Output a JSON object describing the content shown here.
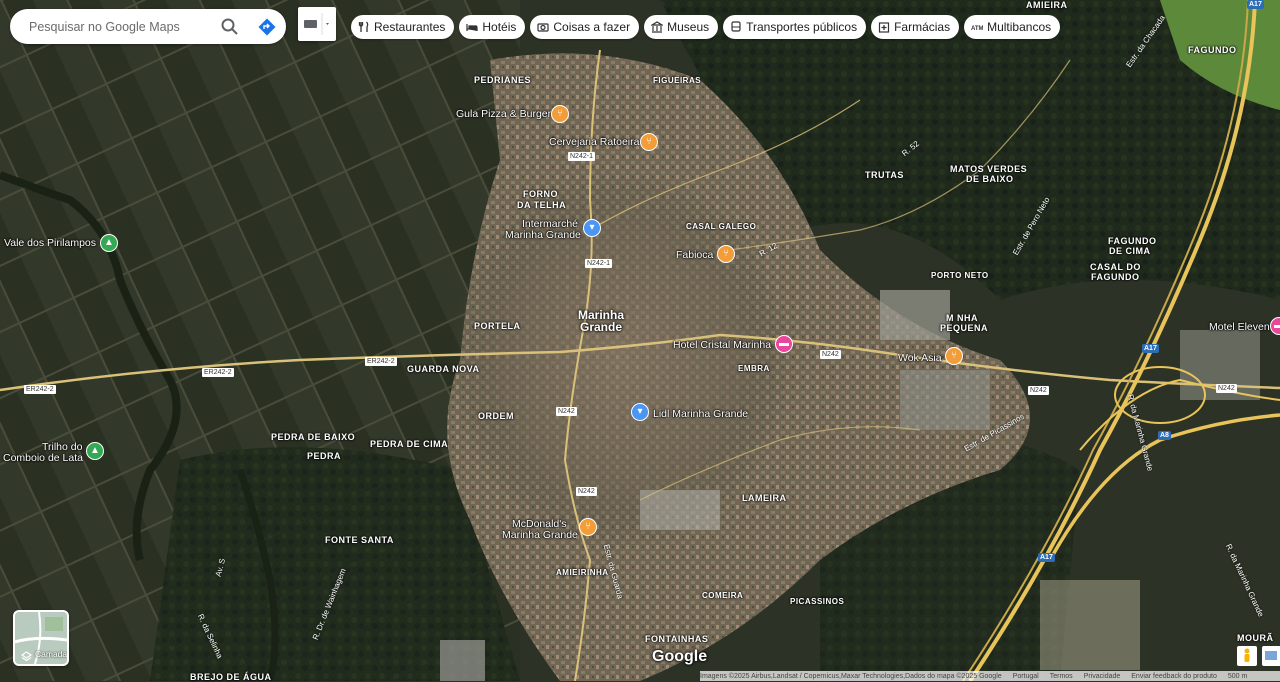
{
  "search": {
    "placeholder": "Pesquisar no Google Maps"
  },
  "icons": {
    "search": "search-icon",
    "directions": "directions-icon",
    "layers": "layers-icon"
  },
  "chips": [
    {
      "label": "Restaurantes",
      "icon": "fork-knife-icon"
    },
    {
      "label": "Hotéis",
      "icon": "bed-icon"
    },
    {
      "label": "Coisas a fazer",
      "icon": "camera-icon"
    },
    {
      "label": "Museus",
      "icon": "museum-icon"
    },
    {
      "label": "Transportes públicos",
      "icon": "bus-icon"
    },
    {
      "label": "Farmácias",
      "icon": "pharmacy-icon"
    },
    {
      "label": "Multibancos",
      "icon": "atm-icon"
    }
  ],
  "places": {
    "amieira": "AMIEIRA",
    "pedrianes": "PEDRIANES",
    "figueiras": "FIGUEIRAS",
    "forno_da_telha_1": "FORNO",
    "forno_da_telha_2": "DA TELHA",
    "trutas": "TRUTAS",
    "matos_verdes_1": "MATOS VERDES",
    "matos_verdes_2": "DE BAIXO",
    "fagundo": "FAGUNDO",
    "fagundo_cima_1": "FAGUNDO",
    "fagundo_cima_2": "DE CIMA",
    "casal_fagundo_1": "CASAL DO",
    "casal_fagundo_2": "FAGUNDO",
    "casal_galego": "CASAL GALEGO",
    "porto_neto": "PORTO NETO",
    "m_nha_pequena_1": "M NHA",
    "m_nha_pequena_2": "PEQUENA",
    "portela": "PORTELA",
    "guarda_nova": "GUARDA NOVA",
    "embra": "EMBRA",
    "ordem": "ORDEM",
    "pedra_de_baixo": "PEDRA DE BAIXO",
    "pedra_de_cima": "PEDRA DE CIMA",
    "pedra": "PEDRA",
    "lameira": "LAMEIRA",
    "fonte_santa": "FONTE SANTA",
    "amieirinha": "AMIEIRINHA",
    "comeira": "COMEIRA",
    "picassinos": "PICASSINOS",
    "fontainhas": "FONTAINHAS",
    "brejo_de_agua": "BREJO DE ÁGUA",
    "mourao": "MOURÃ",
    "marinha_grande_1": "Marinha",
    "marinha_grande_2": "Grande"
  },
  "pois": [
    {
      "name": "Gula Pizza & Burger",
      "type": "restaurant",
      "color": "#f29d38"
    },
    {
      "name": "Cervejaria Ratoeira",
      "type": "restaurant",
      "color": "#f29d38"
    },
    {
      "name1": "Intermarché",
      "name2": "Marinha Grande",
      "type": "shopping",
      "color": "#4b96f3"
    },
    {
      "name": "Fabioca",
      "type": "restaurant",
      "color": "#f29d38"
    },
    {
      "name": "Vale dos Pirilampos",
      "type": "park",
      "color": "#34a853"
    },
    {
      "name": "Hotel Cristal Marinha",
      "type": "hotel",
      "color": "#e8479b"
    },
    {
      "name": "Wok Asia",
      "type": "restaurant",
      "color": "#f29d38"
    },
    {
      "name": "Motel Eleven",
      "type": "hotel",
      "color": "#e8479b"
    },
    {
      "name": "Lidl Marinha Grande",
      "type": "shopping",
      "color": "#4b96f3"
    },
    {
      "name1": "Trilho do",
      "name2": "Comboio de Lata",
      "type": "park",
      "color": "#34a853"
    },
    {
      "name1": "McDonald's",
      "name2": "Marinha Grande",
      "type": "restaurant",
      "color": "#f29d38"
    }
  ],
  "roads": {
    "n2421_a": "N242-1",
    "n2421_b": "N242-1",
    "er2422_a": "ER242-2",
    "er2422_b": "ER242-2",
    "er2422_c": "ER242-2",
    "n242_a": "N242",
    "n242_b": "N242",
    "n242_c": "N242",
    "n242_d": "N242",
    "n242_e": "N242",
    "a17_a": "A17",
    "a17_b": "A17",
    "a17_c": "A17",
    "a8": "A8"
  },
  "streets": {
    "r52": "R. 52",
    "r12": "R. 12",
    "estr_pero_neto": "Estr. de Pero Neto",
    "estr_picassinos": "Estr. de Picassinos",
    "r_marinha_grande_1": "R. da Marinha Grande",
    "r_marinha_grande_2": "R. da Marinha Grande",
    "estr_guarda": "Estr. da Guarda",
    "r_wainhagem": "R. Dr. de Wainhagem",
    "r_selinha": "R. da Selinha",
    "av_s": "Av. S",
    "estr_trutas": "Estr. da Chacada"
  },
  "layers": {
    "label": "Camadas"
  },
  "branding": {
    "logo": "Google"
  },
  "footer": {
    "imagery": "Imagens ©2025 Airbus,Landsat / Copernicus,Maxar Technologies,Dados do mapa ©2025 Google",
    "country": "Portugal",
    "terms": "Termos",
    "privacy": "Privacidade",
    "feedback": "Enviar feedback do produto",
    "scale": "500 m"
  },
  "colors": {
    "restaurant": "#f29d38",
    "shopping": "#4b96f3",
    "hotel": "#e8479b",
    "park": "#34a853",
    "motorway": "#e8c45a",
    "road": "#d9c17a"
  }
}
